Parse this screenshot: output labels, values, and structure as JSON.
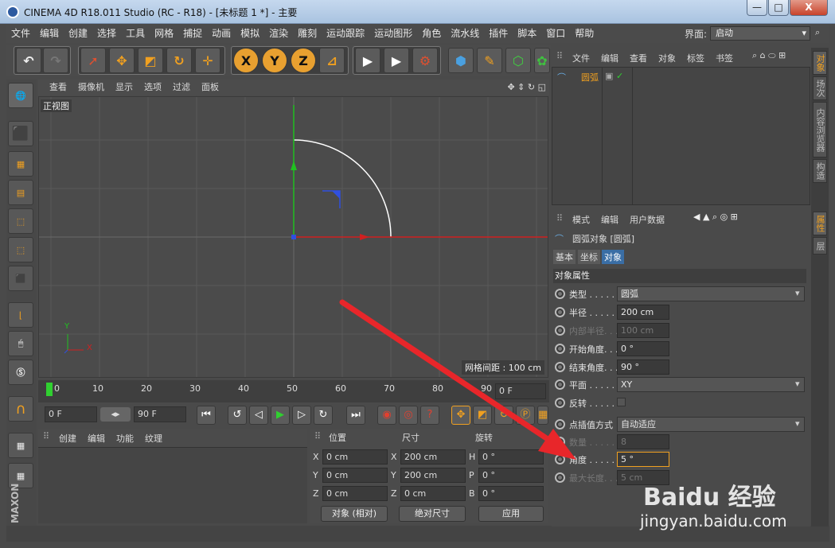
{
  "window": {
    "title": "CINEMA 4D R18.011 Studio (RC - R18) - [未标题 1 *] - 主要",
    "min": "—",
    "max": "□",
    "close": "X"
  },
  "menu": {
    "items": [
      "文件",
      "编辑",
      "创建",
      "选择",
      "工具",
      "网格",
      "捕捉",
      "动画",
      "模拟",
      "渲染",
      "雕刻",
      "运动跟踪",
      "运动图形",
      "角色",
      "流水线",
      "插件",
      "脚本",
      "窗口",
      "帮助"
    ],
    "layout_label": "界面:",
    "layout_value": "启动"
  },
  "toolbar": {
    "axis_x": "X",
    "axis_y": "Y",
    "axis_z": "Z"
  },
  "viewport": {
    "menu": [
      "查看",
      "摄像机",
      "显示",
      "选项",
      "过滤",
      "面板"
    ],
    "view_name": "正视图",
    "grid_note": "网格间距 : 100 cm",
    "axis_y": "Y",
    "axis_x": "X"
  },
  "timeline": {
    "ticks": [
      "0",
      "10",
      "20",
      "30",
      "40",
      "50",
      "60",
      "70",
      "80",
      "90"
    ],
    "current_frame": "0 F",
    "start": "0 F",
    "end": "90 F"
  },
  "material_panel": {
    "tabs": [
      "创建",
      "编辑",
      "功能",
      "纹理"
    ]
  },
  "coords": {
    "headers": {
      "pos": "位置",
      "size": "尺寸",
      "rot": "旋转"
    },
    "rows": [
      {
        "axis": "X",
        "pos": "0 cm",
        "saxis": "X",
        "size": "200 cm",
        "raxis": "H",
        "rot": "0 °"
      },
      {
        "axis": "Y",
        "pos": "0 cm",
        "saxis": "Y",
        "size": "200 cm",
        "raxis": "P",
        "rot": "0 °"
      },
      {
        "axis": "Z",
        "pos": "0 cm",
        "saxis": "Z",
        "size": "0 cm",
        "raxis": "B",
        "rot": "0 °"
      }
    ],
    "mode": "对象 (相对)",
    "size_mode": "绝对尺寸",
    "apply": "应用"
  },
  "objects": {
    "menu": [
      "文件",
      "编辑",
      "查看",
      "对象",
      "标签",
      "书签"
    ],
    "item": "圆弧"
  },
  "attributes": {
    "menu": [
      "模式",
      "编辑",
      "用户数据"
    ],
    "object_title": "圆弧对象 [圆弧]",
    "tabs": [
      "基本",
      "坐标",
      "对象"
    ],
    "section": "对象属性",
    "rows": [
      {
        "label": "类型 . . . . .",
        "value": "圆弧",
        "kind": "drop",
        "enabled": true
      },
      {
        "label": "半径 . . . . .",
        "value": "200 cm",
        "kind": "num",
        "enabled": true
      },
      {
        "label": "内部半径. . .",
        "value": "100 cm",
        "kind": "num",
        "enabled": false
      },
      {
        "label": "开始角度. . .",
        "value": "0 °",
        "kind": "num",
        "enabled": true
      },
      {
        "label": "结束角度. . .",
        "value": "90 °",
        "kind": "num",
        "enabled": true
      },
      {
        "label": "平面 . . . . .",
        "value": "XY",
        "kind": "drop",
        "enabled": true
      },
      {
        "label": "反转 . . . . .",
        "value": "",
        "kind": "check",
        "enabled": true
      }
    ],
    "rows2": [
      {
        "label": "点插值方式",
        "value": "自动适应",
        "kind": "drop",
        "enabled": true
      },
      {
        "label": "数量 . . . . .",
        "value": "8",
        "kind": "num",
        "enabled": false
      },
      {
        "label": "角度 . . . . .",
        "value": "5 °",
        "kind": "num",
        "enabled": true
      },
      {
        "label": "最大长度. . .",
        "value": "5 cm",
        "kind": "num",
        "enabled": false
      }
    ]
  },
  "sidetabs_top": [
    "对象",
    "场次",
    "内容浏览器",
    "构造"
  ],
  "sidetabs_bottom": [
    "属性",
    "层"
  ],
  "watermark": {
    "brand": "Baidu 经验",
    "url": "jingyan.baidu.com"
  },
  "colors": {
    "accent": "#f0a020",
    "arrow": "#e8262a",
    "axis_x": "#d02020",
    "axis_y": "#20c020"
  }
}
